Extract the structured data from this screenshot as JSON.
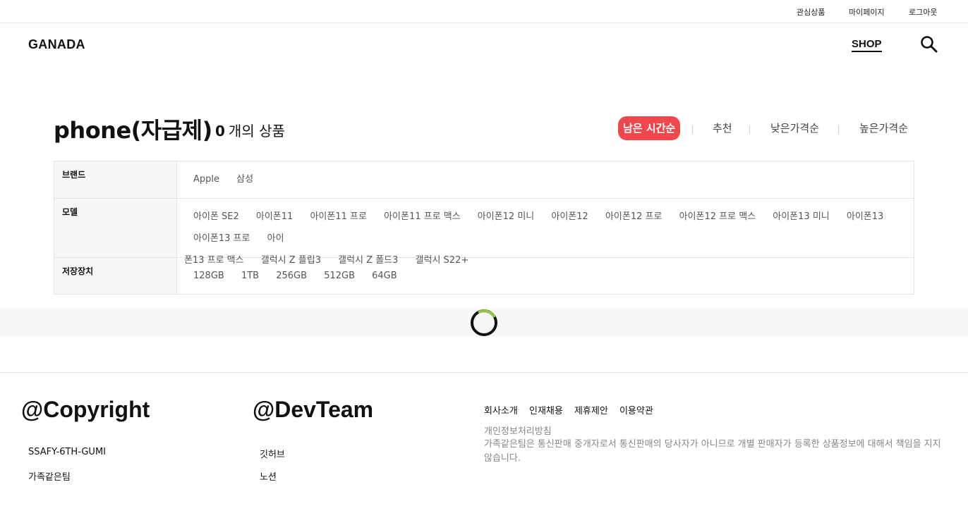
{
  "topbar": {
    "wishlist": "관심상품",
    "mypage": "마이페이지",
    "logout": "로그아웃"
  },
  "header": {
    "logo": "GANADA",
    "shop": "SHOP",
    "search_icon": "search-icon"
  },
  "listing": {
    "category_title": "phone(자급제)",
    "count": "0",
    "count_suffix": "개의 상품"
  },
  "sort": {
    "options": [
      "남은 시간순",
      "추천",
      "낮은가격순",
      "높은가격순"
    ],
    "active": "남은 시간순",
    "accent_color": "#f0474c"
  },
  "filters": {
    "brand": {
      "label": "브랜드",
      "options": [
        "Apple",
        "삼성"
      ]
    },
    "model": {
      "label": "모델",
      "options": [
        "아이폰 SE2",
        "아이폰11",
        "아이폰11 프로",
        "아이폰11 프로 맥스",
        "아이폰12 미니",
        "아이폰12",
        "아이폰12 프로",
        "아이폰12 프로 맥스",
        "아이폰13 미니",
        "아이폰13",
        "아이폰13 프로",
        "아이",
        "폰13 프로 맥스",
        "갤럭시 Z 플립3",
        "갤럭시 Z 폴드3",
        "갤럭시 S22+"
      ]
    },
    "storage": {
      "label": "저장장치",
      "options": [
        "128GB",
        "1TB",
        "256GB",
        "512GB",
        "64GB"
      ]
    }
  },
  "loading": {
    "spinner_color": "#111111",
    "spinner_accent": "#8dc63f"
  },
  "footer": {
    "copyright_title": "@Copyright",
    "copyright_items": [
      "SSAFY-6TH-GUMI",
      "가족같은팀"
    ],
    "devteam_title": "@DevTeam",
    "devteam_items": [
      "깃허브",
      "노션"
    ],
    "links": [
      "회사소개",
      "인재채용",
      "제휴제안",
      "이용약관"
    ],
    "policy": "개인정보처리방침",
    "notice": "가족같은팀은 통신판매 중개자로서 통신판매의 당사자가 아니므로 개별 판매자가 등록한 상품정보에 대해서 책임을 지지 않습니다."
  }
}
